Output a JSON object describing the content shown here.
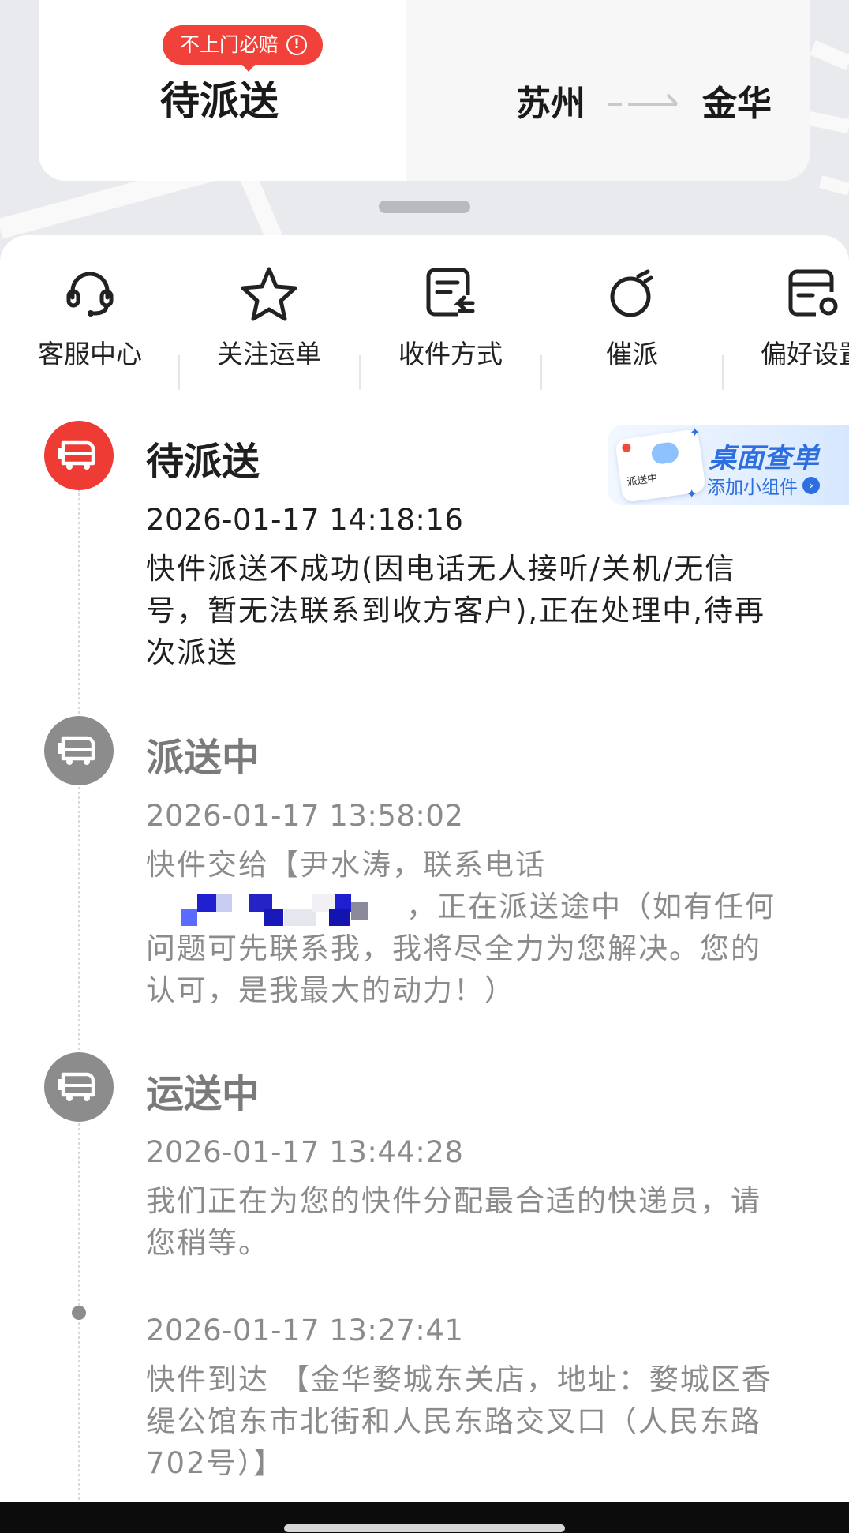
{
  "header": {
    "badge": "不上门必赔",
    "status": "待派送",
    "origin": "苏州",
    "destination": "金华"
  },
  "actions": [
    {
      "label": "客服中心",
      "icon": "headset-icon"
    },
    {
      "label": "关注运单",
      "icon": "star-icon"
    },
    {
      "label": "收件方式",
      "icon": "receive-doc-icon"
    },
    {
      "label": "催派",
      "icon": "stopwatch-icon"
    },
    {
      "label": "偏好设置",
      "icon": "settings-card-icon"
    }
  ],
  "promo": {
    "title": "桌面查单",
    "subtitle": "添加小组件",
    "card_label": "派送中"
  },
  "events": [
    {
      "title": "待派送",
      "time": "2026-01-17 14:18:16",
      "desc": "快件派送不成功(因电话无人接听/关机/无信号，暂无法联系到收方客户),正在处理中,待再次派送",
      "icon": "truck-icon",
      "active": true
    },
    {
      "title": "派送中",
      "time": "2026-01-17 13:58:02",
      "desc_part1": "快件交给【尹水涛，联系电话",
      "desc_part2": "，正在派送途中（如有任何问题可先联系我，我将尽全力为您解决。您的认可，是我最大的动力！）",
      "icon": "truck-icon"
    },
    {
      "title": "运送中",
      "time": "2026-01-17 13:44:28",
      "desc": "我们正在为您的快件分配最合适的快递员，请您稍等。",
      "icon": "truck-icon"
    },
    {
      "title": "",
      "time": "2026-01-17 13:27:41",
      "desc": "快件到达 【金华婺城东关店，地址：婺城区香缇公馆东市北街和人民东路交叉口（人民东路702号）】"
    }
  ],
  "colors": {
    "accent": "#ee3b33",
    "inactive_node": "#8c8c8c",
    "promo_blue": "#2d6fe0"
  }
}
